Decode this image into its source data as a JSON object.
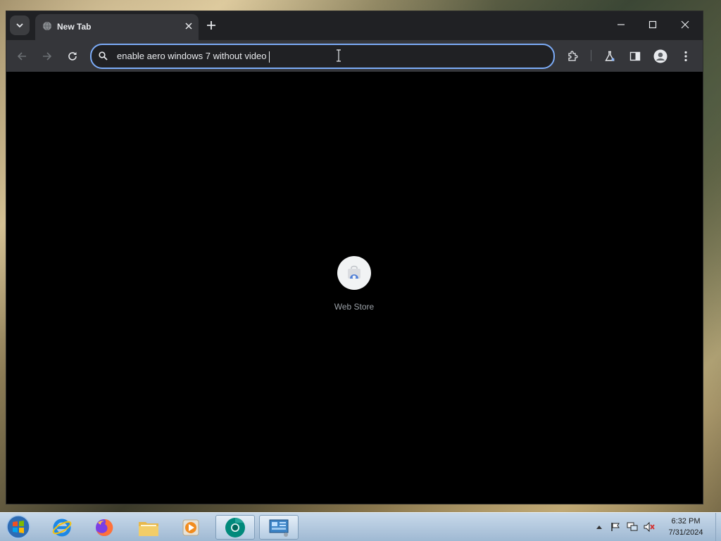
{
  "window": {
    "tab_title": "New Tab",
    "controls": [
      "minimize-icon",
      "maximize-icon",
      "close-icon"
    ]
  },
  "toolbar": {
    "query": "enable aero windows 7 without video",
    "icons": [
      "back-arrow-icon",
      "forward-arrow-icon",
      "reload-icon",
      "search-icon",
      "extensions-icon",
      "labs-flask-icon",
      "side-panel-icon",
      "profile-avatar-icon",
      "more-menu-icon"
    ]
  },
  "shortcuts": [
    {
      "label": "Web Store",
      "icon": "web-store-icon"
    }
  ],
  "taskbar": {
    "apps": [
      "start-orb-icon",
      "internet-explorer-icon",
      "firefox-icon",
      "file-explorer-icon",
      "media-player-icon",
      "chrome-beta-icon",
      "control-panel-icon"
    ],
    "clock": {
      "time": "6:32 PM",
      "date": "7/31/2024"
    }
  },
  "colors": {
    "omnibox_focus": "#7cacf8",
    "titlebar": "#202124",
    "toolbar": "#35363a",
    "content": "#000000"
  }
}
